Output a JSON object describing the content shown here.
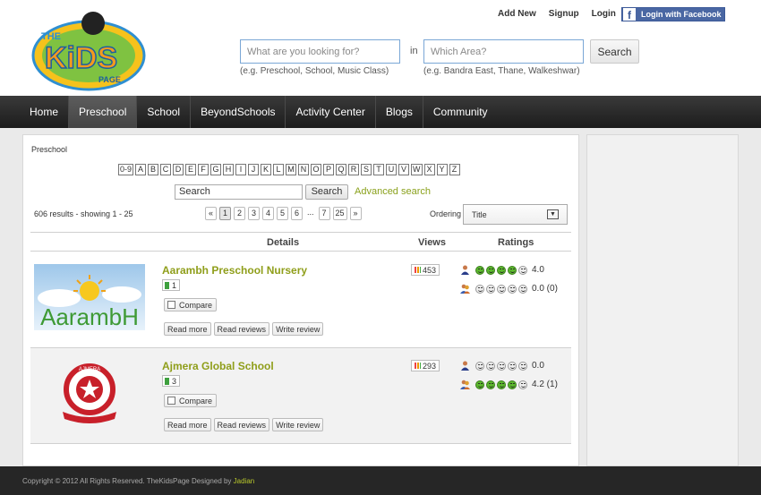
{
  "header": {
    "logo_text": "THE KiDS PAGE",
    "links": [
      "Add New",
      "Signup",
      "Login"
    ],
    "facebook_label": "Login with Facebook",
    "search_what_placeholder": "What are you looking for?",
    "search_in_label": "in",
    "search_where_placeholder": "Which Area?",
    "search_button": "Search",
    "hint_what": "(e.g. Preschool, School, Music Class)",
    "hint_where": "(e.g. Bandra East, Thane, Walkeshwar)"
  },
  "nav": {
    "items": [
      "Home",
      "Preschool",
      "School",
      "BeyondSchools",
      "Activity Center",
      "Blogs",
      "Community"
    ],
    "active": "Preschool"
  },
  "main": {
    "breadcrumb": "Preschool",
    "alphabet": [
      "0-9",
      "A",
      "B",
      "C",
      "D",
      "E",
      "F",
      "G",
      "H",
      "I",
      "J",
      "K",
      "L",
      "M",
      "N",
      "O",
      "P",
      "Q",
      "R",
      "S",
      "T",
      "U",
      "V",
      "W",
      "X",
      "Y",
      "Z"
    ],
    "search_value": "Search",
    "search_button": "Search",
    "advanced_search": "Advanced search",
    "results_text": "606 results - showing 1 - 25",
    "pager": [
      "«",
      "1",
      "2",
      "3",
      "4",
      "5",
      "6",
      "...",
      "7",
      "25",
      "»"
    ],
    "current_page": "1",
    "ordering_label": "Ordering",
    "ordering_value": "Title",
    "columns": {
      "details": "Details",
      "views": "Views",
      "ratings": "Ratings"
    },
    "listings": [
      {
        "name": "Aarambh Preschool Nursery",
        "bookmark_count": "1",
        "compare_label": "Compare",
        "actions": [
          "Read more",
          "Read reviews",
          "Write review"
        ],
        "views": "453",
        "editor_rating": {
          "value": "4.0",
          "stars": 4
        },
        "user_rating": {
          "value": "0.0 (0)",
          "stars": 0
        },
        "logo_text": "AarambH"
      },
      {
        "name": "Ajmera Global School",
        "bookmark_count": "3",
        "compare_label": "Compare",
        "actions": [
          "Read more",
          "Read reviews",
          "Write review"
        ],
        "views": "293",
        "editor_rating": {
          "value": "0.0",
          "stars": 0
        },
        "user_rating": {
          "value": "4.2 (1)",
          "stars": 4
        },
        "logo_text": "AJMERA"
      }
    ]
  },
  "footer": {
    "copyright": "Copyright © 2012 All Rights Reserved. TheKidsPage Designed by ",
    "designer": "Jadian"
  },
  "colors": {
    "accent_green": "#8f9e1a",
    "nav_bg": "#262626",
    "facebook": "#4a67a3"
  }
}
